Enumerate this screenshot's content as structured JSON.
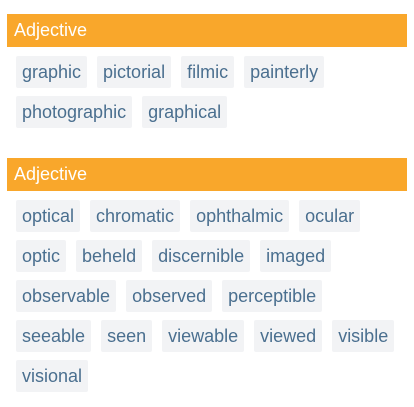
{
  "sections": [
    {
      "header": "Adjective",
      "words": [
        "graphic",
        "pictorial",
        "filmic",
        "painterly",
        "photographic",
        "graphical"
      ]
    },
    {
      "header": "Adjective",
      "words": [
        "optical",
        "chromatic",
        "ophthalmic",
        "ocular",
        "optic",
        "beheld",
        "discernible",
        "imaged",
        "observable",
        "observed",
        "perceptible",
        "seeable",
        "seen",
        "viewable",
        "viewed",
        "visible",
        "visional"
      ]
    }
  ],
  "colors": {
    "header_background": "#f9a72b",
    "header_text": "#ffffff",
    "chip_background": "#f2f3f5",
    "chip_text": "#4a6f8f"
  }
}
